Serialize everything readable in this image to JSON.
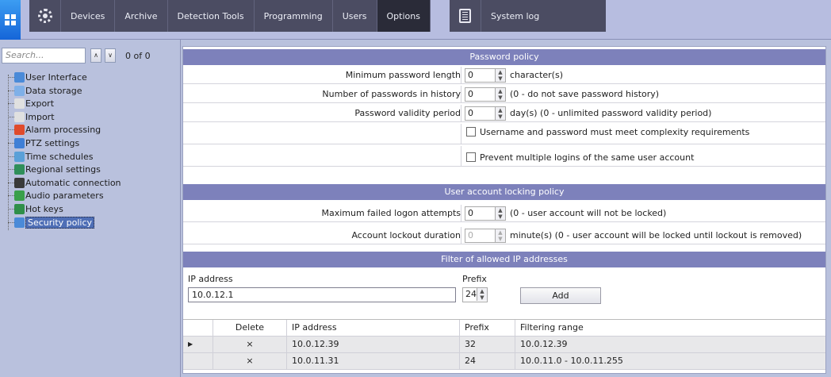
{
  "toolbar": {
    "tabs": [
      {
        "label": "Devices"
      },
      {
        "label": "Archive"
      },
      {
        "label": "Detection Tools"
      },
      {
        "label": "Programming"
      },
      {
        "label": "Users"
      },
      {
        "label": "Options",
        "active": true
      },
      {
        "label": "System log"
      }
    ],
    "icons": {
      "logo": "grid-logo-icon",
      "options": "gear-icon",
      "syslog": "log-sheet-icon"
    }
  },
  "left": {
    "search_placeholder": "Search...",
    "counter": "0 of 0",
    "tree": [
      {
        "label": "User Interface",
        "icon": "window-icon",
        "color": "#4a8ad8"
      },
      {
        "label": "Data storage",
        "icon": "database-icon",
        "color": "#7fb0e8"
      },
      {
        "label": "Export",
        "icon": "export-icon",
        "color": "#e0e0e0"
      },
      {
        "label": "Import",
        "icon": "import-icon",
        "color": "#e0e0e0"
      },
      {
        "label": "Alarm processing",
        "icon": "alarm-icon",
        "color": "#e04b2c"
      },
      {
        "label": "PTZ settings",
        "icon": "ptz-icon",
        "color": "#3f7fd6"
      },
      {
        "label": "Time schedules",
        "icon": "schedule-icon",
        "color": "#5aa0d8"
      },
      {
        "label": "Regional settings",
        "icon": "globe-icon",
        "color": "#2f8f5a"
      },
      {
        "label": "Automatic connection",
        "icon": "connection-icon",
        "color": "#3a3a3a"
      },
      {
        "label": "Audio parameters",
        "icon": "audio-icon",
        "color": "#3aa04a"
      },
      {
        "label": "Hot keys",
        "icon": "hotkeys-icon",
        "color": "#2f8f4a"
      },
      {
        "label": "Security policy",
        "icon": "security-icon",
        "color": "#4a8ad8",
        "selected": true
      }
    ]
  },
  "password_policy": {
    "header": "Password policy",
    "min_length": {
      "label": "Minimum password length",
      "value": "0",
      "suffix": "character(s)"
    },
    "history": {
      "label": "Number of passwords in history",
      "value": "0",
      "suffix": "(0 - do not save password history)"
    },
    "validity": {
      "label": "Password validity period",
      "value": "0",
      "suffix": "day(s) (0 - unlimited password validity period)"
    },
    "complexity": {
      "label": "Username and password must meet complexity requirements",
      "checked": false
    },
    "multi_login": {
      "label": "Prevent multiple logins of the same user account",
      "checked": false
    }
  },
  "locking_policy": {
    "header": "User account locking policy",
    "max_attempts": {
      "label": "Maximum failed logon attempts",
      "value": "0",
      "suffix": "(0 - user account will not be locked)"
    },
    "lockout": {
      "label": "Account lockout duration",
      "value": "0",
      "suffix": "minute(s) (0 - user account will be locked until lockout is removed)"
    }
  },
  "ip_filter": {
    "header": "Filter of allowed IP addresses",
    "ip_label": "IP address",
    "ip_value": "10.0.12.1",
    "prefix_label": "Prefix",
    "prefix_value": "24",
    "add_label": "Add",
    "columns": [
      "",
      "Delete",
      "IP address",
      "Prefix",
      "Filtering range"
    ],
    "rows": [
      {
        "marker": "▶",
        "delete": "×",
        "ip": "10.0.12.39",
        "prefix": "32",
        "range": "10.0.12.39"
      },
      {
        "marker": "",
        "delete": "×",
        "ip": "10.0.11.31",
        "prefix": "24",
        "range": "10.0.11.0 - 10.0.11.255"
      }
    ]
  }
}
